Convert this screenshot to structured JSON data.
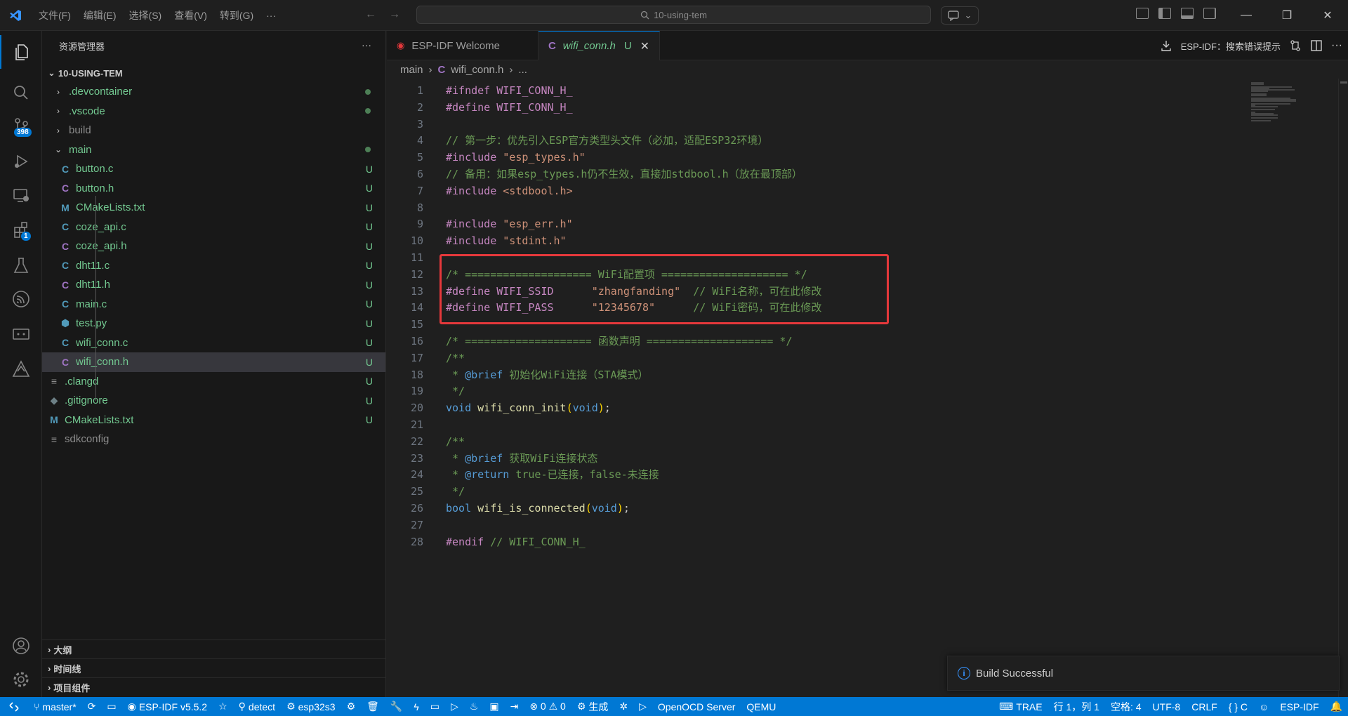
{
  "titlebar": {
    "menu": [
      "文件(F)",
      "编辑(E)",
      "选择(S)",
      "查看(V)",
      "转到(G)",
      "···"
    ],
    "search": "10-using-tem",
    "window_controls": [
      "—",
      "❐",
      "✕"
    ]
  },
  "activity": {
    "source_control_badge": "398",
    "extensions_badge": "1"
  },
  "sidebar": {
    "title": "资源管理器",
    "root": "10-USING-TEM",
    "items": [
      {
        "label": ".devcontainer",
        "kind": "folder",
        "status": "dot"
      },
      {
        "label": ".vscode",
        "kind": "folder",
        "status": "dot"
      },
      {
        "label": "build",
        "kind": "folder",
        "status": ""
      },
      {
        "label": "main",
        "kind": "folder-open",
        "status": "dot"
      },
      {
        "label": "button.c",
        "kind": "c",
        "status": "U"
      },
      {
        "label": "button.h",
        "kind": "h",
        "status": "U"
      },
      {
        "label": "CMakeLists.txt",
        "kind": "m",
        "status": "U"
      },
      {
        "label": "coze_api.c",
        "kind": "c",
        "status": "U"
      },
      {
        "label": "coze_api.h",
        "kind": "h",
        "status": "U"
      },
      {
        "label": "dht11.c",
        "kind": "c",
        "status": "U"
      },
      {
        "label": "dht11.h",
        "kind": "h",
        "status": "U"
      },
      {
        "label": "main.c",
        "kind": "c",
        "status": "U"
      },
      {
        "label": "test.py",
        "kind": "py",
        "status": "U"
      },
      {
        "label": "wifi_conn.c",
        "kind": "c",
        "status": "U"
      },
      {
        "label": "wifi_conn.h",
        "kind": "h",
        "status": "U"
      },
      {
        "label": ".clangd",
        "kind": "txt",
        "status": "U"
      },
      {
        "label": ".gitignore",
        "kind": "git",
        "status": "U"
      },
      {
        "label": "CMakeLists.txt",
        "kind": "m",
        "status": "U"
      },
      {
        "label": "sdkconfig",
        "kind": "txt",
        "status": ""
      }
    ],
    "bottom_sections": [
      "大纲",
      "时间线",
      "项目组件"
    ]
  },
  "tabs": [
    {
      "label": "ESP-IDF Welcome",
      "active": false
    },
    {
      "label": "wifi_conn.h",
      "active": true,
      "status": "U"
    }
  ],
  "tabs_right": {
    "label": "ESP-IDF：搜索错误提示"
  },
  "breadcrumb": [
    "main",
    "wifi_conn.h",
    "..."
  ],
  "code": [
    {
      "n": "1",
      "parts": [
        [
          "kw",
          "#ifndef "
        ],
        [
          "mname",
          "WIFI_CONN_H_"
        ]
      ]
    },
    {
      "n": "2",
      "parts": [
        [
          "kw",
          "#define "
        ],
        [
          "mname",
          "WIFI_CONN_H_"
        ]
      ]
    },
    {
      "n": "3",
      "parts": []
    },
    {
      "n": "4",
      "parts": [
        [
          "cm",
          "// 第一步：优先引入ESP官方类型头文件（必加，适配ESP32环境）"
        ]
      ]
    },
    {
      "n": "5",
      "parts": [
        [
          "kw",
          "#include "
        ],
        [
          "str",
          "\"esp_types.h\""
        ]
      ]
    },
    {
      "n": "6",
      "parts": [
        [
          "cm",
          "// 备用：如果esp_types.h仍不生效，直接加stdbool.h（放在最顶部）"
        ]
      ]
    },
    {
      "n": "7",
      "parts": [
        [
          "kw",
          "#include "
        ],
        [
          "tag",
          "<stdbool.h>"
        ]
      ]
    },
    {
      "n": "8",
      "parts": []
    },
    {
      "n": "9",
      "parts": [
        [
          "kw",
          "#include "
        ],
        [
          "str",
          "\"esp_err.h\""
        ]
      ]
    },
    {
      "n": "10",
      "parts": [
        [
          "kw",
          "#include "
        ],
        [
          "str",
          "\"stdint.h\""
        ]
      ]
    },
    {
      "n": "11",
      "parts": []
    },
    {
      "n": "12",
      "parts": [
        [
          "cm",
          "/* ==================== WiFi配置项 ==================== */"
        ]
      ]
    },
    {
      "n": "13",
      "parts": [
        [
          "kw",
          "#define "
        ],
        [
          "mname",
          "WIFI_SSID      "
        ],
        [
          "str",
          "\"zhangfanding\""
        ],
        [
          "cm",
          "  // WiFi名称，可在此修改"
        ]
      ]
    },
    {
      "n": "14",
      "parts": [
        [
          "kw",
          "#define "
        ],
        [
          "mname",
          "WIFI_PASS      "
        ],
        [
          "str",
          "\"12345678\""
        ],
        [
          "cm",
          "      // WiFi密码，可在此修改"
        ]
      ]
    },
    {
      "n": "15",
      "parts": []
    },
    {
      "n": "16",
      "parts": [
        [
          "cm",
          "/* ==================== 函数声明 ==================== */"
        ]
      ]
    },
    {
      "n": "17",
      "parts": [
        [
          "cm",
          "/**"
        ]
      ]
    },
    {
      "n": "18",
      "parts": [
        [
          "cm",
          " * "
        ],
        [
          "doc",
          "@brief"
        ],
        [
          "cm",
          " 初始化WiFi连接（STA模式）"
        ]
      ]
    },
    {
      "n": "19",
      "parts": [
        [
          "cm",
          " */"
        ]
      ]
    },
    {
      "n": "20",
      "parts": [
        [
          "ty",
          "void "
        ],
        [
          "fn",
          "wifi_conn_init"
        ],
        [
          "pn",
          "("
        ],
        [
          "ty",
          "void"
        ],
        [
          "pn",
          ")"
        ],
        [
          "plain",
          ";"
        ]
      ]
    },
    {
      "n": "21",
      "parts": []
    },
    {
      "n": "22",
      "parts": [
        [
          "cm",
          "/**"
        ]
      ]
    },
    {
      "n": "23",
      "parts": [
        [
          "cm",
          " * "
        ],
        [
          "doc",
          "@brief"
        ],
        [
          "cm",
          " 获取WiFi连接状态"
        ]
      ]
    },
    {
      "n": "24",
      "parts": [
        [
          "cm",
          " * "
        ],
        [
          "doc",
          "@return"
        ],
        [
          "cm",
          " true-已连接，false-未连接"
        ]
      ]
    },
    {
      "n": "25",
      "parts": [
        [
          "cm",
          " */"
        ]
      ]
    },
    {
      "n": "26",
      "parts": [
        [
          "ty",
          "bool "
        ],
        [
          "fn",
          "wifi_is_connected"
        ],
        [
          "pn",
          "("
        ],
        [
          "ty",
          "void"
        ],
        [
          "pn",
          ")"
        ],
        [
          "plain",
          ";"
        ]
      ]
    },
    {
      "n": "27",
      "parts": []
    },
    {
      "n": "28",
      "parts": [
        [
          "kw",
          "#endif "
        ],
        [
          "cm",
          "// WIFI_CONN_H_"
        ]
      ]
    }
  ],
  "notification": {
    "text": "Build Successful"
  },
  "statusbar": {
    "left": [
      {
        "icon": "branch-icon",
        "label": "master*"
      },
      {
        "icon": "sync-icon",
        "label": ""
      },
      {
        "icon": "folder-icon",
        "label": ""
      },
      {
        "icon": "esp-icon",
        "label": "ESP-IDF v5.5.2"
      },
      {
        "icon": "star-icon",
        "label": ""
      },
      {
        "icon": "plug-icon",
        "label": "detect"
      },
      {
        "icon": "chip-icon",
        "label": "esp32s3"
      },
      {
        "icon": "gear-icon",
        "label": ""
      },
      {
        "icon": "trash-icon",
        "label": ""
      },
      {
        "icon": "wrench-icon",
        "label": ""
      },
      {
        "icon": "flash-icon",
        "label": ""
      },
      {
        "icon": "monitor-icon",
        "label": ""
      },
      {
        "icon": "debug-icon",
        "label": ""
      },
      {
        "icon": "fire-icon",
        "label": ""
      },
      {
        "icon": "terminal-icon",
        "label": ""
      },
      {
        "icon": "export-icon",
        "label": ""
      },
      {
        "icon": "problems-icon",
        "label": "⊗ 0 ⚠ 0"
      },
      {
        "icon": "build-icon",
        "label": "生成"
      },
      {
        "icon": "bug-icon",
        "label": ""
      },
      {
        "icon": "play-icon",
        "label": ""
      },
      {
        "icon": "",
        "label": "OpenOCD Server"
      },
      {
        "icon": "",
        "label": "QEMU"
      }
    ],
    "right": [
      {
        "icon": "keyboard-icon",
        "label": "TRAE"
      },
      {
        "icon": "",
        "label": "行 1，列 1"
      },
      {
        "icon": "",
        "label": "空格: 4"
      },
      {
        "icon": "",
        "label": "UTF-8"
      },
      {
        "icon": "",
        "label": "CRLF"
      },
      {
        "icon": "",
        "label": "{ } C"
      },
      {
        "icon": "copilot-icon",
        "label": ""
      },
      {
        "icon": "",
        "label": "ESP-IDF"
      },
      {
        "icon": "bell-icon",
        "label": ""
      }
    ]
  }
}
